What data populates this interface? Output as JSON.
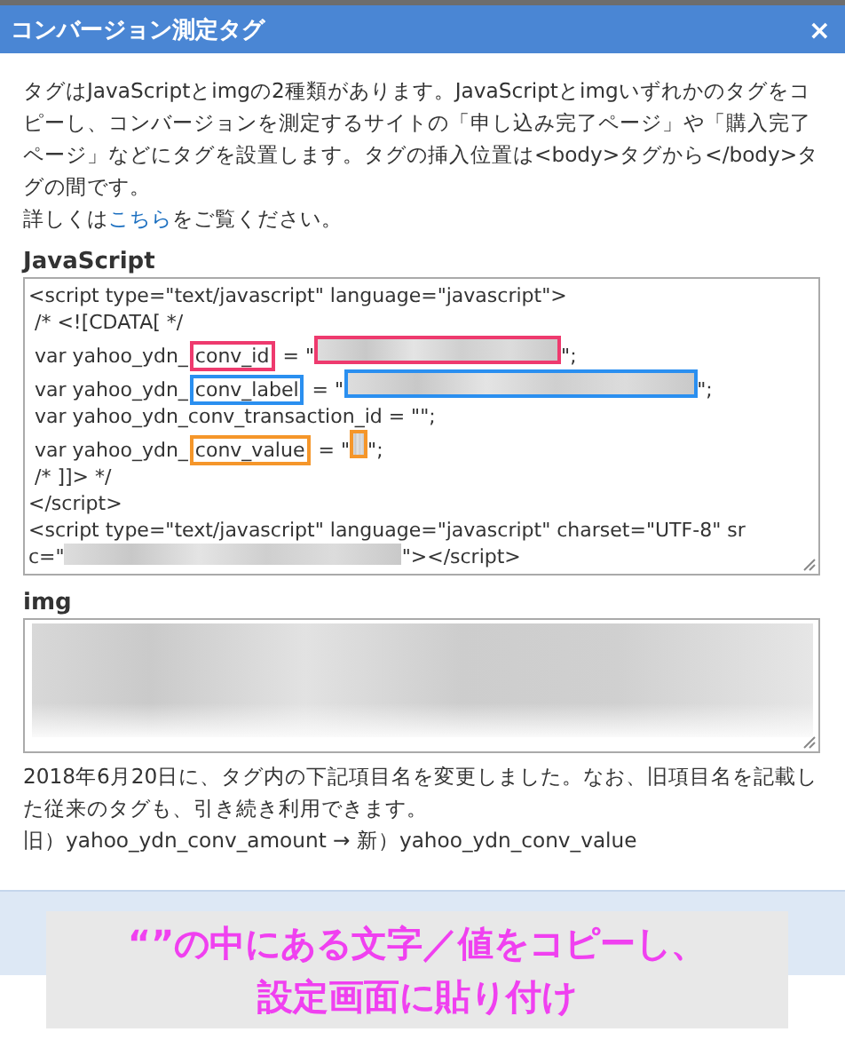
{
  "window": {
    "title": "コンバージョン測定タグ",
    "close": "×"
  },
  "intro": "タグはJavaScriptとimgの2種類があります。JavaScriptとimgいずれかのタグをコピーし、コンバージョンを測定するサイトの「申し込み完了ページ」や「購入完了ページ」などにタグを設置します。タグの挿入位置は<body>タグから</body>タグの間です。",
  "more": {
    "before": "詳しくは",
    "link": "こちら",
    "after": "をご覧ください。"
  },
  "javascript": {
    "label": "JavaScript",
    "lines": [
      [
        {
          "kind": "text",
          "text": "<script type=\"text/javascript\" language=\"javascript\">"
        }
      ],
      [
        {
          "kind": "text",
          "text": " /* <![CDATA[ */"
        }
      ],
      [
        {
          "kind": "text",
          "text": " var yahoo_ydn_"
        },
        {
          "kind": "mark",
          "text": "conv_id",
          "color": "#ee3a6e"
        },
        {
          "kind": "text",
          "text": " = \""
        },
        {
          "kind": "blur",
          "color": "#ee3a6e"
        },
        {
          "kind": "text",
          "text": "\";"
        }
      ],
      [
        {
          "kind": "text",
          "text": " var yahoo_ydn_"
        },
        {
          "kind": "mark",
          "text": "conv_label",
          "color": "#2a8ff0"
        },
        {
          "kind": "text",
          "text": " = \""
        },
        {
          "kind": "blur",
          "color": "#2a8ff0"
        },
        {
          "kind": "text",
          "text": "\";"
        }
      ],
      [
        {
          "kind": "text",
          "text": " var yahoo_ydn_conv_transaction_id = \"\";"
        }
      ],
      [
        {
          "kind": "text",
          "text": " var yahoo_ydn_"
        },
        {
          "kind": "mark",
          "text": "conv_value",
          "color": "#f5962a"
        },
        {
          "kind": "text",
          "text": " = \""
        },
        {
          "kind": "blur",
          "color": "#f5962a"
        },
        {
          "kind": "text",
          "text": "\";"
        }
      ],
      [
        {
          "kind": "text",
          "text": " /* ]]> */"
        }
      ],
      [
        {
          "kind": "text",
          "text": "</script>"
        }
      ],
      [
        {
          "kind": "text",
          "text": "<script type=\"text/javascript\" language=\"javascript\" charset=\"UTF-8\" sr"
        }
      ],
      [
        {
          "kind": "text",
          "text": "c=\""
        },
        {
          "kind": "blur"
        },
        {
          "kind": "text",
          "text": "\"></script>"
        }
      ]
    ]
  },
  "img": {
    "label": "img"
  },
  "notice": "2018年6月20日に、タグ内の下記項目名を変更しました。なお、旧項目名を記載した従来のタグも、引き続き利用できます。",
  "rename": "旧）yahoo_ydn_conv_amount → 新）yahoo_ydn_conv_value",
  "annotation": [
    "“”の中にある文字／値をコピーし、",
    "設定画面に貼り付け"
  ]
}
